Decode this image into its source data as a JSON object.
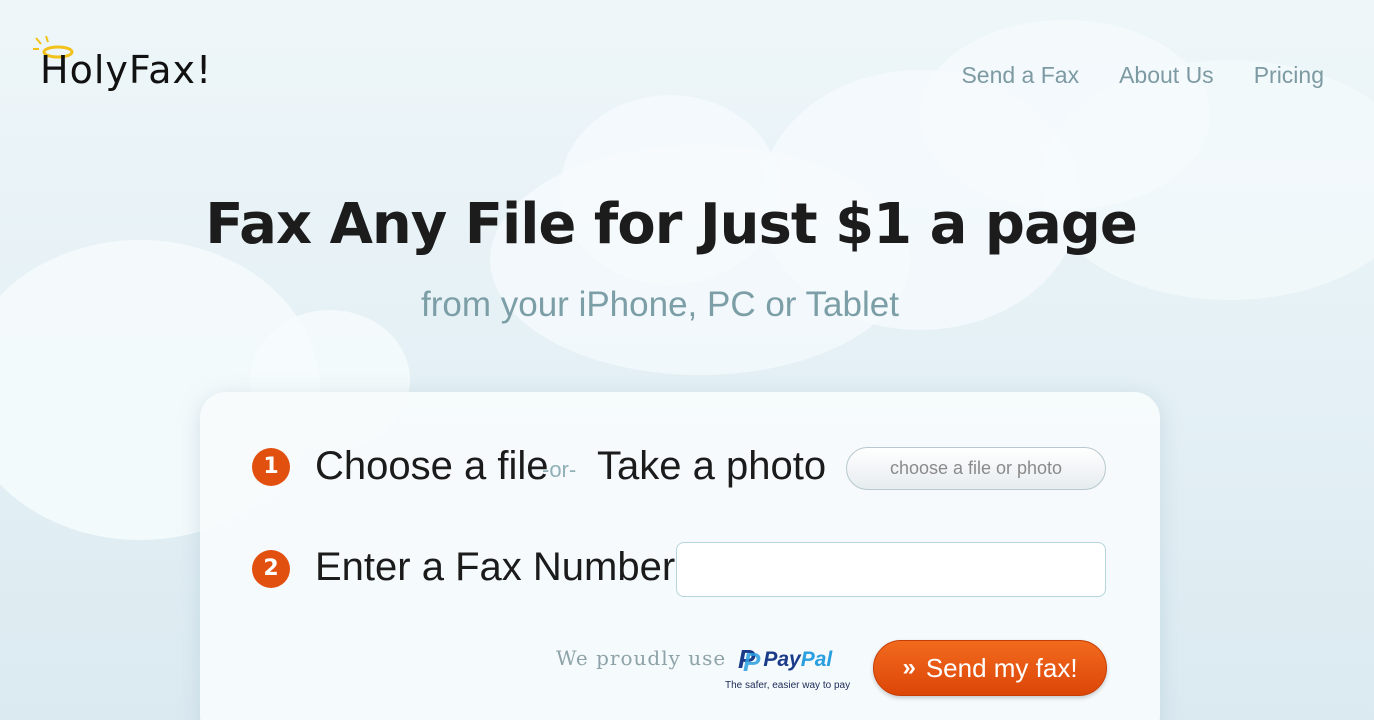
{
  "brand": {
    "name": "HolyFax!"
  },
  "nav": {
    "items": [
      "Send a Fax",
      "About Us",
      "Pricing"
    ]
  },
  "hero": {
    "title": "Fax Any File for Just $1 a page",
    "subtitle": "from your iPhone, PC or Tablet"
  },
  "form": {
    "step1": {
      "number": "1",
      "choose_label": "Choose a file",
      "or_label": "-or-",
      "photo_label": "Take a photo",
      "button_label": "choose a file or photo"
    },
    "step2": {
      "number": "2",
      "label": "Enter a Fax Number",
      "value": "",
      "placeholder": ""
    },
    "payment": {
      "proud_text": "We proudly use",
      "paypal_pay": "Pay",
      "paypal_pal": "Pal",
      "paypal_tagline": "The safer, easier way to pay"
    },
    "submit_label": "Send my fax!",
    "submit_icon": "double-chevron-right-icon"
  },
  "colors": {
    "accent": "#e2500f",
    "nav": "#7d9aa3",
    "subtitle": "#7c9ea6",
    "paypal_dark": "#1a3a8a",
    "paypal_light": "#2a9fe0"
  }
}
